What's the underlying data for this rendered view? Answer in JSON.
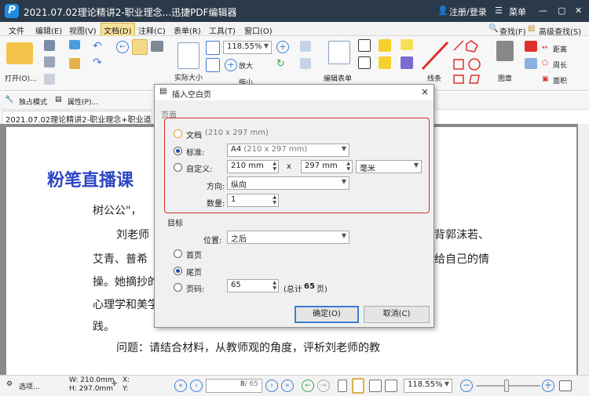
{
  "window": {
    "title": "2021.07.02理论精讲2-职业理念...迅捷PDF编辑器",
    "logo_letter": "P",
    "login": "注册/登录",
    "menu": "菜单"
  },
  "menubar": [
    "文件",
    "编辑(E)",
    "视图(V)",
    "文档(D)",
    "注释(C)",
    "表单(R)",
    "工具(T)",
    "窗口(O)"
  ],
  "ribbon": {
    "open": "打开(O)...",
    "zoom_value": "118.55%",
    "zoom_in": "放大",
    "zoom_out": "缩小",
    "actual_size": "实际大小",
    "edit_form": "编辑表单",
    "line": "线条",
    "stamp": "图章",
    "distance": "距离",
    "perimeter": "周长",
    "area": "面积",
    "find": "查找(F)",
    "advanced_find": "高级查找(S)"
  },
  "toolbar2": {
    "mode": "独占模式",
    "properties": "属性(P)..."
  },
  "doc_tab": "2021.07.02理论精讲2-职业理念+职业道德知",
  "document": {
    "logo": "粉笔直播课",
    "lines": [
      "树公公\"，",
      "刘老师",
      "艾青、普希",
      "操。她摘抄的",
      "心理学和美学",
      "践。",
      "问题：请结合材料，从教师观的角度，评析刘老师的教"
    ],
    "right_fragments": [
      "背郭沫若、",
      "给自己的情"
    ]
  },
  "dialog": {
    "title": "插入空白页",
    "close": "×",
    "section_page": "页面",
    "opt_document": "文档",
    "doc_size": "(210 x 297 mm)",
    "opt_standard": "标准:",
    "standard_value": "A4",
    "standard_size": "(210 x 297 mm)",
    "opt_custom": "自定义:",
    "width": "210 mm",
    "times": "x",
    "height": "297 mm",
    "unit": "毫米",
    "orientation_label": "方向:",
    "orientation_value": "纵向",
    "count_label": "数量:",
    "count_value": "1",
    "section_target": "目标",
    "position_label": "位置:",
    "position_value": "之后",
    "opt_first": "首页",
    "opt_last": "尾页",
    "opt_page": "页码:",
    "page_value": "65",
    "total_prefix": "(总计",
    "total_count": "65",
    "total_suffix": "页)",
    "ok": "确定(O)",
    "cancel": "取消(C)",
    "selected_radio_page": "standard",
    "selected_radio_target": "last"
  },
  "statusbar": {
    "options": "选项...",
    "w": "W: 210.0mm",
    "h": "H: 297.0mm",
    "x": "X:",
    "y": "Y:",
    "page_current": "8",
    "page_total": "/ 65",
    "zoom": "118.55%"
  },
  "colors": {
    "titlebar": "#2b3a4a",
    "highlight_box": "#d9312b",
    "accent": "#3c7fd1",
    "doc_logo": "#2c46c4"
  }
}
